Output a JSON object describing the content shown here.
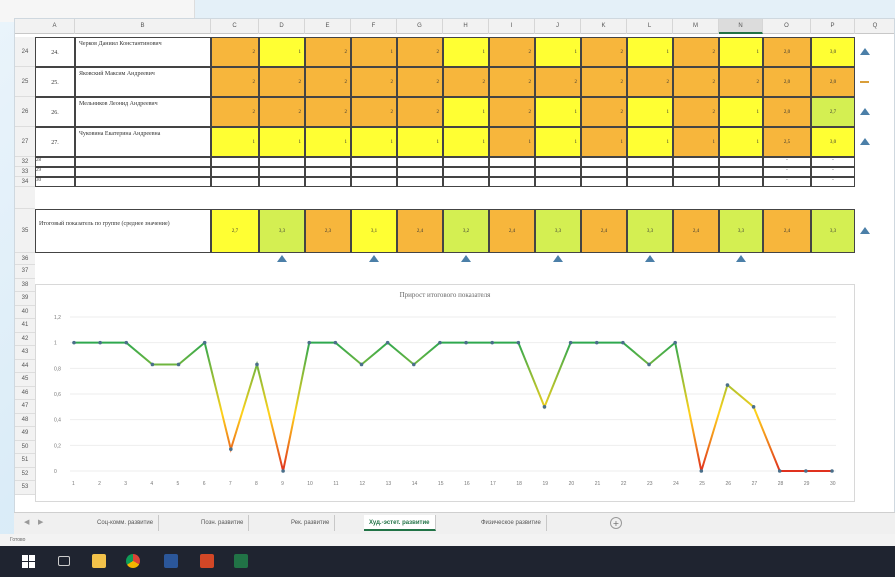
{
  "columns": [
    "A",
    "B",
    "C",
    "D",
    "E",
    "F",
    "G",
    "H",
    "I",
    "J",
    "K",
    "L",
    "M",
    "N",
    "O",
    "P",
    "Q"
  ],
  "selected_column": "N",
  "rows": [
    {
      "rownum": "24",
      "idx": "24.",
      "name": "Черков Даниил Константинович",
      "vals": [
        "2",
        "1",
        "2",
        "1",
        "2",
        "1",
        "2",
        "1",
        "2",
        "1",
        "2",
        "1",
        "2"
      ],
      "colors": [
        "orange",
        "yellow",
        "orange",
        "orange",
        "orange",
        "yellow",
        "orange",
        "yellow",
        "orange",
        "yellow",
        "orange",
        "yellow",
        "lyellow",
        "yellow"
      ],
      "avg1": "2,0",
      "avg2": "3,0",
      "trend": "up"
    },
    {
      "rownum": "25",
      "idx": "25.",
      "name": "Яковский Максим Андреевич",
      "vals": [
        "2",
        "2",
        "2",
        "2",
        "2",
        "2",
        "2",
        "2",
        "2",
        "2",
        "2",
        "2",
        "2"
      ],
      "colors": [
        "orange",
        "orange",
        "orange",
        "orange",
        "orange",
        "orange",
        "orange",
        "orange",
        "orange",
        "orange",
        "orange",
        "orange",
        "orange",
        "orange"
      ],
      "avg1": "2,0",
      "avg2": "2,0",
      "trend": "flat"
    },
    {
      "rownum": "26",
      "idx": "26.",
      "name": "Мельников Леонид Андреевич",
      "vals": [
        "2",
        "2",
        "2",
        "2",
        "2",
        "1",
        "2",
        "1",
        "2",
        "1",
        "2",
        "1",
        "2"
      ],
      "colors": [
        "orange",
        "orange",
        "orange",
        "orange",
        "orange",
        "yellow",
        "orange",
        "yellow",
        "orange",
        "yellow",
        "orange",
        "yellow",
        "orange",
        "lgreen"
      ],
      "avg1": "2,0",
      "avg2": "2,7",
      "trend": "up"
    },
    {
      "rownum": "27",
      "idx": "27.",
      "name": "Чуковина Екатерина Андреевна",
      "vals": [
        "1",
        "1",
        "1",
        "1",
        "1",
        "1",
        "1",
        "1",
        "1",
        "1",
        "1",
        "1",
        "1"
      ],
      "colors": [
        "yellow",
        "yellow",
        "yellow",
        "yellow",
        "yellow",
        "yellow",
        "orange",
        "yellow",
        "orange",
        "yellow",
        "orange",
        "yellow",
        "yellow",
        "yellow"
      ],
      "avg1": "2,5",
      "avg2": "3,0",
      "trend": "up"
    }
  ],
  "blank_rows": [
    {
      "rownum": "32",
      "idx": "28",
      "dashes": [
        "-",
        "-"
      ]
    },
    {
      "rownum": "33",
      "idx": "29",
      "dashes": [
        "-",
        "-"
      ]
    },
    {
      "rownum": "34",
      "idx": "30",
      "dashes": [
        "-",
        "-"
      ]
    }
  ],
  "summary": {
    "rownum": "35",
    "label": "Итоговый показатель по группе (среднее значение)",
    "values": [
      "2,7",
      "3,3",
      "2,3",
      "3,1",
      "2,4",
      "3,2",
      "2,4",
      "3,3",
      "2,4",
      "3,3",
      "2,4",
      "3,3",
      "2,4",
      "3,3"
    ],
    "colors": [
      "yellow",
      "lgreen",
      "orange",
      "yellow",
      "orange",
      "lgreen",
      "orange",
      "lgreen",
      "orange",
      "lgreen",
      "orange",
      "lgreen",
      "orange",
      "lgreen"
    ],
    "trend": "up"
  },
  "row_numbers_below": [
    "36",
    "37",
    "38",
    "39",
    "40",
    "41",
    "42",
    "43",
    "44",
    "45",
    "46",
    "47",
    "48",
    "49",
    "50",
    "51",
    "52",
    "53"
  ],
  "chart_data": {
    "type": "line",
    "title": "Прирост итогового показателя",
    "x": [
      1,
      2,
      3,
      4,
      5,
      6,
      7,
      8,
      9,
      10,
      11,
      12,
      13,
      14,
      15,
      16,
      17,
      18,
      19,
      20,
      21,
      22,
      23,
      24,
      25,
      26,
      27,
      28,
      29,
      30
    ],
    "series": [
      {
        "values": [
          1,
          1,
          1,
          0.83,
          0.83,
          1,
          0.17,
          0.83,
          0,
          1,
          1,
          0.83,
          1,
          0.83,
          1,
          1,
          1,
          1,
          0.5,
          1,
          1,
          1,
          0.83,
          1,
          0,
          0.67,
          0.5,
          0,
          0,
          0
        ]
      }
    ],
    "ylim": [
      0,
      1.2
    ],
    "yticks": [
      "0",
      "0,2",
      "0,4",
      "0,6",
      "0,8",
      "1",
      "1,2"
    ],
    "grid": true
  },
  "sheet_tabs": [
    "Соц-комм. развитие",
    "Позн. развитие",
    "Рек. развитие",
    "Худ.-эстет. развитие",
    "Физическое развитие"
  ],
  "active_tab": "Худ.-эстет. развитие",
  "add_sheet": "+",
  "status": "Готово",
  "taskbar_icons": [
    "windows-icon",
    "task-view-icon",
    "file-explorer-icon",
    "chrome-icon",
    "word-icon",
    "powerpoint-icon",
    "excel-icon"
  ]
}
